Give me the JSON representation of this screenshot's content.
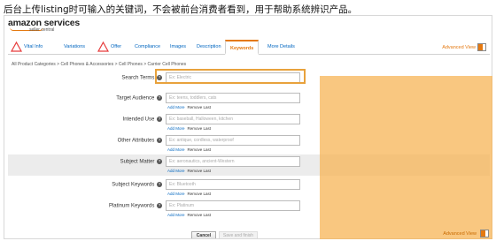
{
  "caption": "后台上传listing时可输入的关键词，不会被前台消费者看到，用于帮助系统辨识产品。",
  "brand": {
    "name": "amazon services",
    "sub": "seller central"
  },
  "tabs": [
    {
      "label": "Vital Info",
      "icon": "warning-icon",
      "active": false
    },
    {
      "label": "Variations",
      "active": false
    },
    {
      "label": "Offer",
      "icon": "warning-icon",
      "active": false
    },
    {
      "label": "Compliance",
      "active": false
    },
    {
      "label": "Images",
      "active": false
    },
    {
      "label": "Description",
      "active": false
    },
    {
      "label": "Keywords",
      "active": true
    },
    {
      "label": "More Details",
      "active": false
    }
  ],
  "advanced_view": "Advanced View",
  "breadcrumb": "All Product Categories > Cell Phones & Accessories > Cell Phones > Carrier Cell Phones",
  "fields": [
    {
      "label": "Search Terms",
      "placeholder": "Ex: Electric",
      "links": false,
      "shaded": false
    },
    {
      "label": "Target Audience",
      "placeholder": "Ex: teens, toddlers, cats",
      "links": true,
      "shaded": false
    },
    {
      "label": "Intended Use",
      "placeholder": "Ex: baseball, Halloween, kitchen",
      "links": true,
      "shaded": false
    },
    {
      "label": "Other Attributes",
      "placeholder": "Ex: antique, cordless, waterproof",
      "links": true,
      "shaded": false
    },
    {
      "label": "Subject Matter",
      "placeholder": "Ex: aeronautics, ancient-Western",
      "links": true,
      "shaded": true
    },
    {
      "label": "Subject Keywords",
      "placeholder": "Ex: Bluetooth",
      "links": true,
      "shaded": false
    },
    {
      "label": "Platinum Keywords",
      "placeholder": "Ex: Platinum",
      "links": true,
      "shaded": false
    }
  ],
  "link_labels": {
    "add": "Add More",
    "remove": "Remove Last"
  },
  "buttons": {
    "cancel": "Cancel",
    "save": "Save and finish"
  },
  "colors": {
    "accent": "#e47911",
    "link": "#0066c0",
    "overlay": "#f7b24f"
  }
}
